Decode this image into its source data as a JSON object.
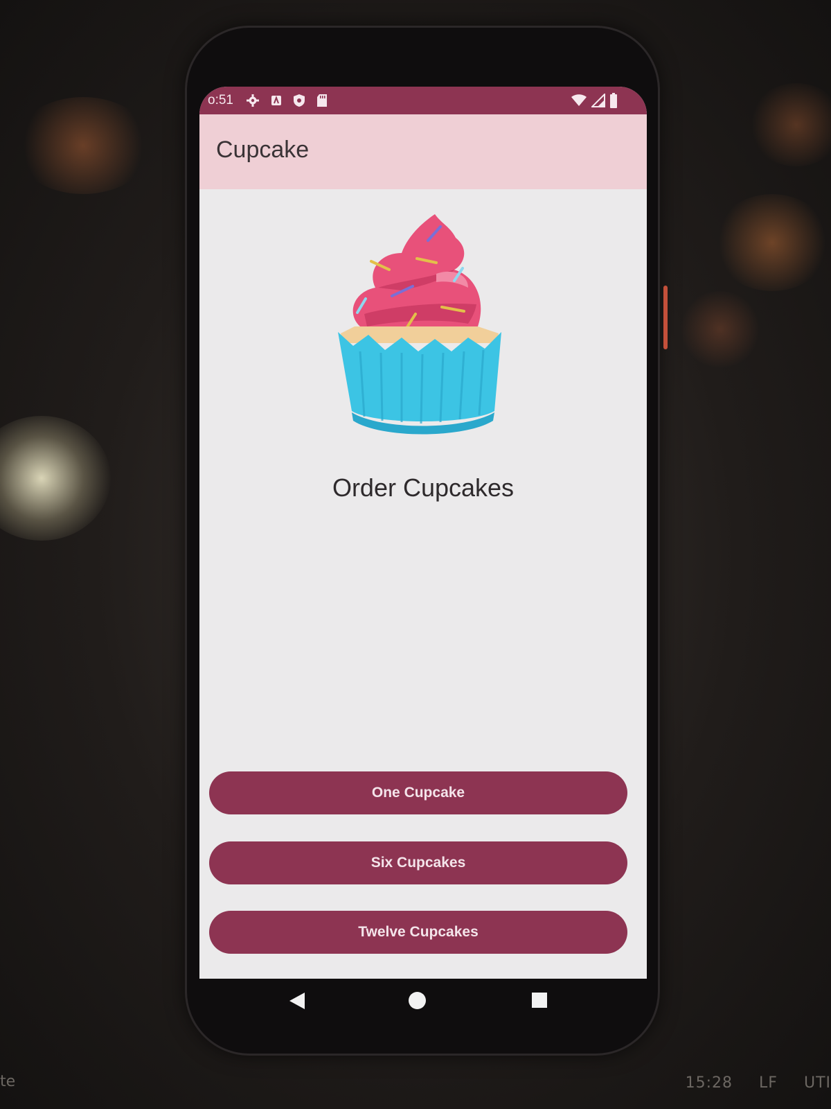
{
  "status_bar": {
    "time": "o:51",
    "left_icons": [
      "settings-icon",
      "notification-icon",
      "shield-icon",
      "sd-card-icon"
    ],
    "right_icons": [
      "wifi-icon",
      "signal-icon",
      "battery-icon"
    ]
  },
  "app_bar": {
    "title": "Cupcake"
  },
  "main": {
    "image": "cupcake-illustration",
    "heading": "Order Cupcakes"
  },
  "buttons": {
    "one": "One Cupcake",
    "six": "Six Cupcakes",
    "twelve": "Twelve Cupcakes"
  },
  "nav": [
    "back-icon",
    "home-icon",
    "recents-icon"
  ],
  "ide": {
    "left_fragment": "te",
    "time": "15:28",
    "line_ending": "LF",
    "encoding": "UTI"
  },
  "colors": {
    "primary": "#8d3452",
    "app_bar": "#efcfd5",
    "background": "#ebeaeb",
    "frosting": "#e8517a",
    "wrapper": "#3cc4e4"
  }
}
